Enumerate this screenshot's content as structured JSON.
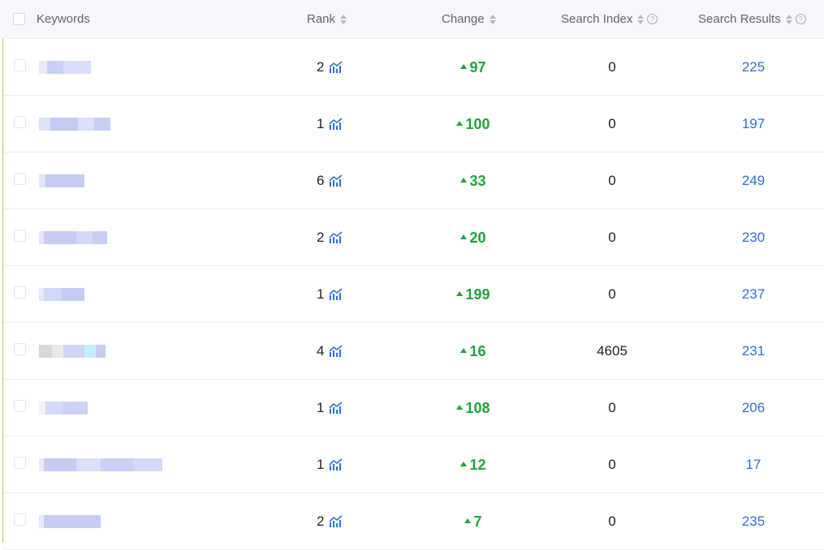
{
  "header": {
    "keywords": "Keywords",
    "rank": "Rank",
    "change": "Change",
    "search_index": "Search Index",
    "search_results": "Search Results"
  },
  "icons": {
    "sort": "sort-icon",
    "help": "help-icon",
    "trend": "trend-chart-icon",
    "change_up": "triangle-up-icon"
  },
  "colors": {
    "change_positive": "#21a339",
    "link": "#2f6fd6",
    "trend_icon": "#2f6fd6"
  },
  "rows": [
    {
      "rank": "2",
      "change": "97",
      "search_index": "0",
      "search_results": "225"
    },
    {
      "rank": "1",
      "change": "100",
      "search_index": "0",
      "search_results": "197"
    },
    {
      "rank": "6",
      "change": "33",
      "search_index": "0",
      "search_results": "249"
    },
    {
      "rank": "2",
      "change": "20",
      "search_index": "0",
      "search_results": "230"
    },
    {
      "rank": "1",
      "change": "199",
      "search_index": "0",
      "search_results": "237"
    },
    {
      "rank": "4",
      "change": "16",
      "search_index": "4605",
      "search_results": "231"
    },
    {
      "rank": "1",
      "change": "108",
      "search_index": "0",
      "search_results": "206"
    },
    {
      "rank": "1",
      "change": "12",
      "search_index": "0",
      "search_results": "17"
    },
    {
      "rank": "2",
      "change": "7",
      "search_index": "0",
      "search_results": "235"
    }
  ]
}
